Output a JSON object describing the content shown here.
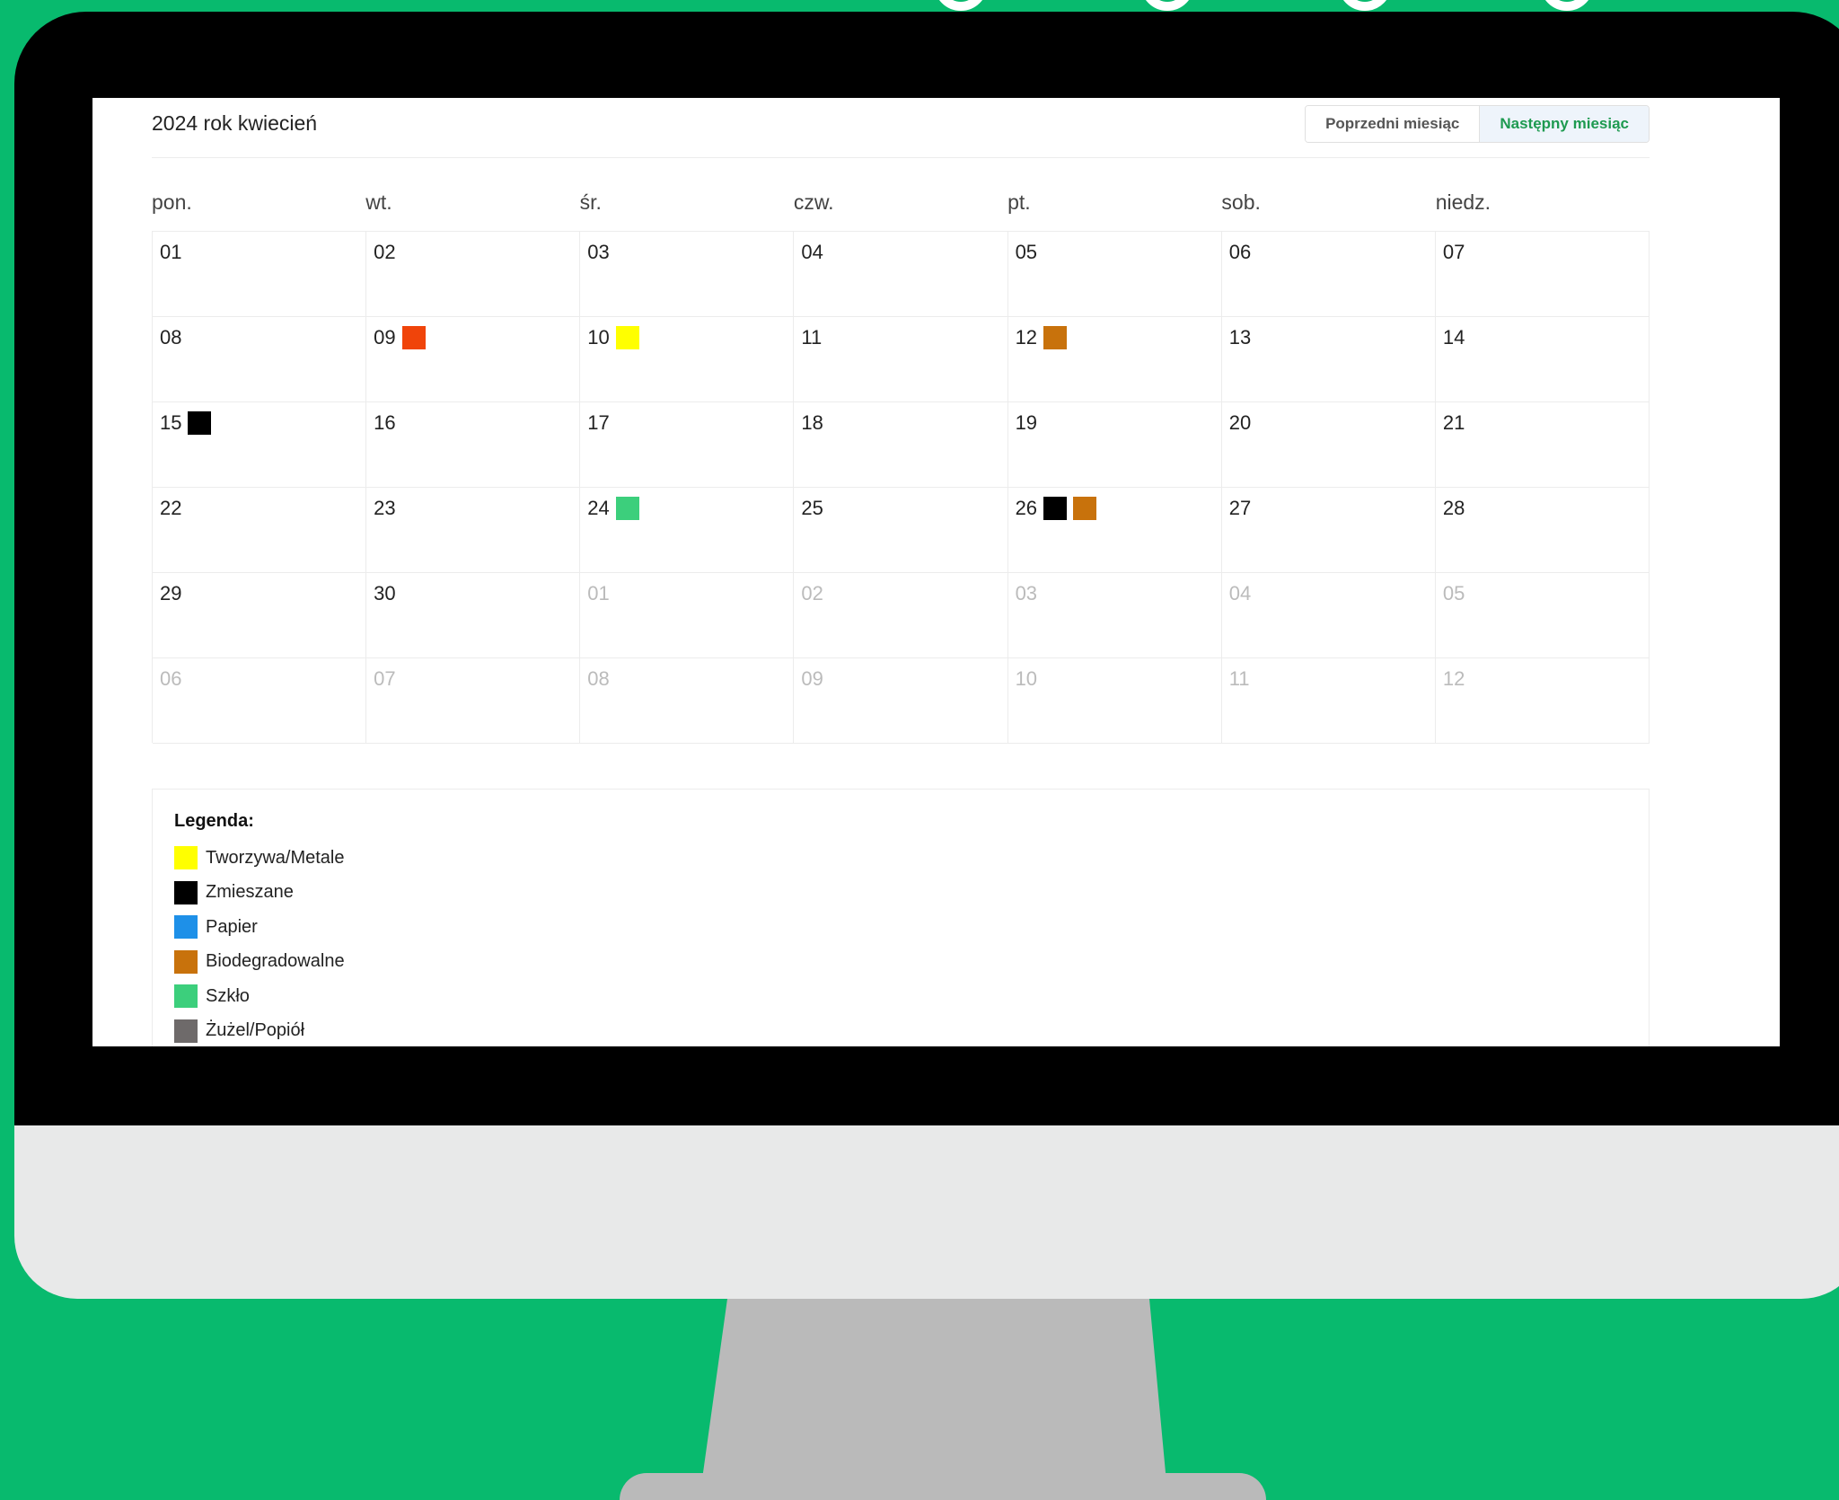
{
  "header": {
    "title": "2024 rok kwiecień",
    "prev_label": "Poprzedni miesiąc",
    "next_label": "Następny miesiąc"
  },
  "weekdays": [
    "pon.",
    "wt.",
    "śr.",
    "czw.",
    "pt.",
    "sob.",
    "niedz."
  ],
  "colors": {
    "yellow": "#FFFF00",
    "black": "#000000",
    "blue": "#1E90E8",
    "brown": "#C8720C",
    "green": "#3CCF7C",
    "gray": "#6E6A6A",
    "red": "#F0440A"
  },
  "calendar": {
    "rows": [
      [
        {
          "d": "01"
        },
        {
          "d": "02"
        },
        {
          "d": "03"
        },
        {
          "d": "04"
        },
        {
          "d": "05"
        },
        {
          "d": "06"
        },
        {
          "d": "07"
        }
      ],
      [
        {
          "d": "08"
        },
        {
          "d": "09",
          "m": [
            "#F0440A"
          ]
        },
        {
          "d": "10",
          "m": [
            "#FFFF00"
          ]
        },
        {
          "d": "11"
        },
        {
          "d": "12",
          "m": [
            "#C8720C"
          ]
        },
        {
          "d": "13"
        },
        {
          "d": "14"
        }
      ],
      [
        {
          "d": "15",
          "m": [
            "#000000"
          ]
        },
        {
          "d": "16"
        },
        {
          "d": "17"
        },
        {
          "d": "18"
        },
        {
          "d": "19"
        },
        {
          "d": "20"
        },
        {
          "d": "21"
        }
      ],
      [
        {
          "d": "22"
        },
        {
          "d": "23"
        },
        {
          "d": "24",
          "m": [
            "#3CCF7C"
          ]
        },
        {
          "d": "25"
        },
        {
          "d": "26",
          "m": [
            "#000000",
            "#C8720C"
          ]
        },
        {
          "d": "27"
        },
        {
          "d": "28"
        }
      ],
      [
        {
          "d": "29"
        },
        {
          "d": "30"
        },
        {
          "d": "01",
          "o": true
        },
        {
          "d": "02",
          "o": true
        },
        {
          "d": "03",
          "o": true
        },
        {
          "d": "04",
          "o": true
        },
        {
          "d": "05",
          "o": true
        }
      ],
      [
        {
          "d": "06",
          "o": true
        },
        {
          "d": "07",
          "o": true
        },
        {
          "d": "08",
          "o": true
        },
        {
          "d": "09",
          "o": true
        },
        {
          "d": "10",
          "o": true
        },
        {
          "d": "11",
          "o": true
        },
        {
          "d": "12",
          "o": true
        }
      ]
    ]
  },
  "legend": {
    "title": "Legenda:",
    "items": [
      {
        "label": "Tworzywa/Metale",
        "color": "#FFFF00"
      },
      {
        "label": "Zmieszane",
        "color": "#000000"
      },
      {
        "label": "Papier",
        "color": "#1E90E8"
      },
      {
        "label": "Biodegradowalne",
        "color": "#C8720C"
      },
      {
        "label": "Szkło",
        "color": "#3CCF7C"
      },
      {
        "label": "Żużel/Popiół",
        "color": "#6E6A6A"
      }
    ]
  }
}
